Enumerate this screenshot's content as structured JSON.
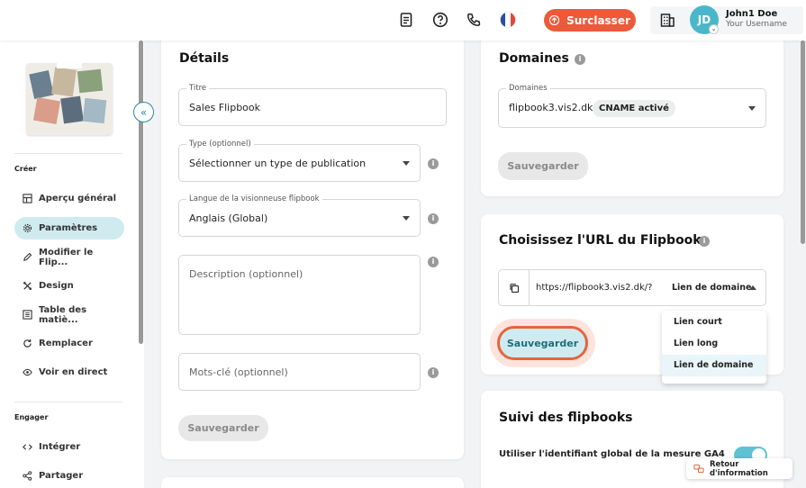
{
  "topbar": {
    "upgrade_label": "Surclasser",
    "user_initials": "JD",
    "user_name": "John1 Doe",
    "user_subtitle": "Your Username"
  },
  "sidebar": {
    "sections": [
      {
        "title": "Créer",
        "items": [
          {
            "label": "Aperçu général",
            "icon": "layout-icon",
            "active": false
          },
          {
            "label": "Paramètres",
            "icon": "gear-icon",
            "active": true
          },
          {
            "label": "Modifier le Flip...",
            "icon": "pencil-icon",
            "active": false
          },
          {
            "label": "Design",
            "icon": "design-tools-icon",
            "active": false
          },
          {
            "label": "Table des matiè...",
            "icon": "table-of-contents-icon",
            "active": false
          },
          {
            "label": "Remplacer",
            "icon": "refresh-icon",
            "active": false
          },
          {
            "label": "Voir en direct",
            "icon": "eye-icon",
            "active": false
          }
        ]
      },
      {
        "title": "Engager",
        "items": [
          {
            "label": "Intégrer",
            "icon": "code-icon",
            "active": false
          },
          {
            "label": "Partager",
            "icon": "share-icon",
            "active": false
          }
        ]
      }
    ]
  },
  "details": {
    "title": "Détails",
    "title_field": {
      "label": "Titre",
      "value": "Sales Flipbook"
    },
    "type_field": {
      "label": "Type (optionnel)",
      "value": "Sélectionner un type de publication"
    },
    "language_field": {
      "label": "Langue de la visionneuse flipbook",
      "value": "Anglais (Global)"
    },
    "description_placeholder": "Description (optionnel)",
    "keywords_placeholder": "Mots-clé (optionnel)",
    "save_label": "Sauvegarder"
  },
  "domains": {
    "title": "Domaines",
    "field_label": "Domaines",
    "value": "flipbook3.vis2.dk",
    "badge": "CNAME activé",
    "save_label": "Sauvegarder"
  },
  "url_card": {
    "title": "Choisissez l'URL du Flipbook",
    "url_value": "https://flipbook3.vis2.dk/?",
    "type_value": "Lien de domaine",
    "save_label": "Sauvegarder",
    "options": [
      "Lien court",
      "Lien long",
      "Lien de domaine"
    ],
    "selected_option": "Lien de domaine"
  },
  "tracking": {
    "title": "Suivi des flipbooks",
    "ga4_label": "Utiliser l'identifiant global de la mesure GA4",
    "ga4_enabled": true
  },
  "report_label": "Retour d'information",
  "colors": {
    "accent": "#4ab6c9",
    "upgrade": "#ec5a3a",
    "active_nav": "#cfebf0"
  }
}
